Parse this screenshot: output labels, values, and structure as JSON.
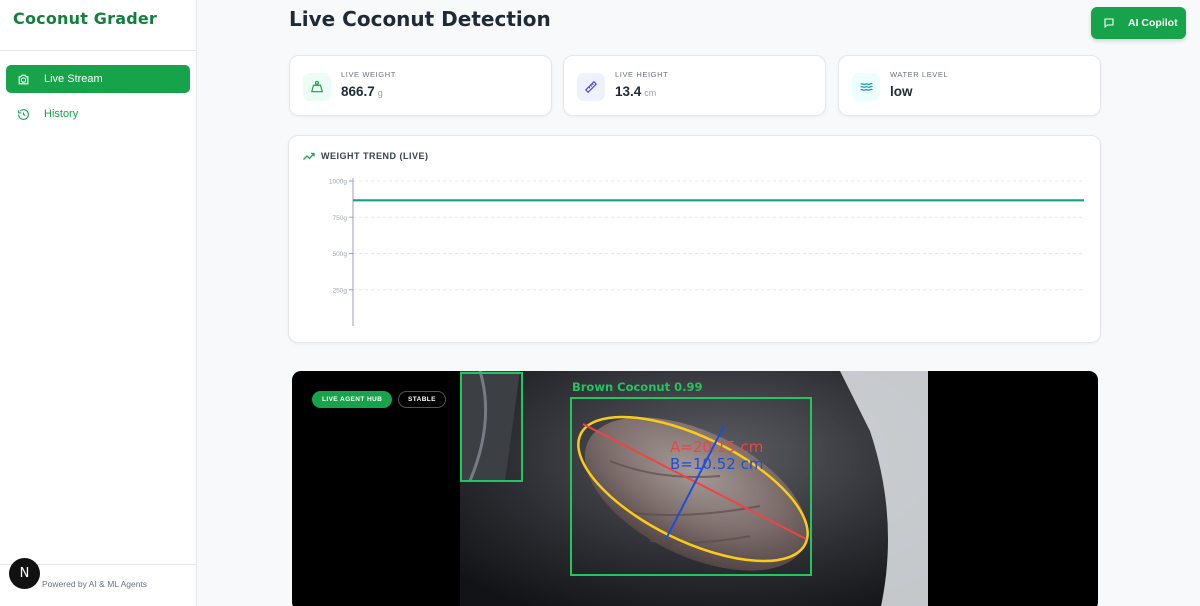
{
  "sidebar": {
    "brand": "Coconut Grader",
    "items": [
      {
        "label": "Live Stream",
        "icon": "camera-icon",
        "active": true
      },
      {
        "label": "History",
        "icon": "history-icon",
        "active": false
      }
    ],
    "footer": "Powered by AI & ML Agents",
    "badge": "N"
  },
  "header": {
    "title": "Live Coconut Detection",
    "copilot_label": "AI Copilot"
  },
  "stats": [
    {
      "label": "LIVE WEIGHT",
      "value": "866.7",
      "unit": "g",
      "icon": "weight-icon"
    },
    {
      "label": "LIVE HEIGHT",
      "value": "13.4",
      "unit": "cm",
      "icon": "ruler-icon"
    },
    {
      "label": "WATER LEVEL",
      "value": "low",
      "unit": "",
      "icon": "waves-icon"
    }
  ],
  "chart_title": "WEIGHT TREND (LIVE)",
  "chart_data": {
    "type": "line",
    "title": "WEIGHT TREND (LIVE)",
    "y_ticks": [
      "1000g",
      "750g",
      "500g",
      "250g"
    ],
    "ylim": [
      0,
      1000
    ],
    "grid": true,
    "series": [
      {
        "values": [
          866.7,
          866.7
        ]
      }
    ],
    "line_color": "#10a37f"
  },
  "video": {
    "hub_label": "LIVE AGENT HUB",
    "status_label": "STABLE",
    "detection_label": "Brown Coconut 0.99",
    "axis_a": "A=20.15 cm",
    "axis_b": "B=10.52 cm"
  },
  "colors": {
    "accent": "#16a34a",
    "box": "#22c55e",
    "ellipse": "#facc15",
    "axis_a": "#ef4444",
    "axis_b": "#1d4ed8"
  }
}
